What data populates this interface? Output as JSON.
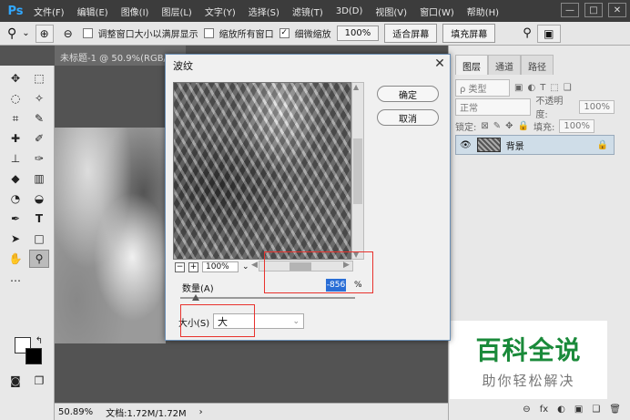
{
  "app": {
    "logo": "Ps"
  },
  "menu": [
    "文件(F)",
    "编辑(E)",
    "图像(I)",
    "图层(L)",
    "文字(Y)",
    "选择(S)",
    "滤镜(T)",
    "3D(D)",
    "视图(V)",
    "窗口(W)",
    "帮助(H)"
  ],
  "window_controls": {
    "minimize": "—",
    "restore": "□",
    "close": "✕"
  },
  "options": {
    "zoom_dropdown": "⌄",
    "resize_windows": "调整窗口大小以满屏显示",
    "zoom_all": "缩放所有窗口",
    "scrubby_zoom": "细微缩放",
    "zoom_percent": "100%",
    "fit_screen": "适合屏幕",
    "fill_screen": "填充屏幕"
  },
  "document_tab": "未标题-1 @ 50.9%(RGB/8#",
  "status": {
    "zoom": "50.89%",
    "doc_info": "文档:1.72M/1.72M"
  },
  "layers_panel": {
    "tabs": [
      "图层",
      "通道",
      "路径"
    ],
    "filter_type": "ρ 类型",
    "blend_mode": "正常",
    "opacity_label": "不透明度:",
    "opacity_value": "100%",
    "lock_label": "锁定:",
    "fill_label": "填充:",
    "fill_value": "100%",
    "layer_name": "背景",
    "footer_icons": [
      "⊖",
      "fx",
      "◐",
      "▣",
      "❑",
      "🗑"
    ]
  },
  "dialog": {
    "title": "波纹",
    "ok": "确定",
    "cancel": "取消",
    "preview_zoom": "100%",
    "amount_label": "数量(A)",
    "amount_value": "-856",
    "amount_unit": "%",
    "amount_slider": -856,
    "size_label": "大小(S)",
    "size_value": "大"
  },
  "watermark": {
    "title": "百科全说",
    "subtitle": "助你轻松解决"
  },
  "colors": {
    "menubar": "#3c3c3c",
    "watermark_green": "#1a8a3a",
    "highlight": "#e8322d"
  }
}
